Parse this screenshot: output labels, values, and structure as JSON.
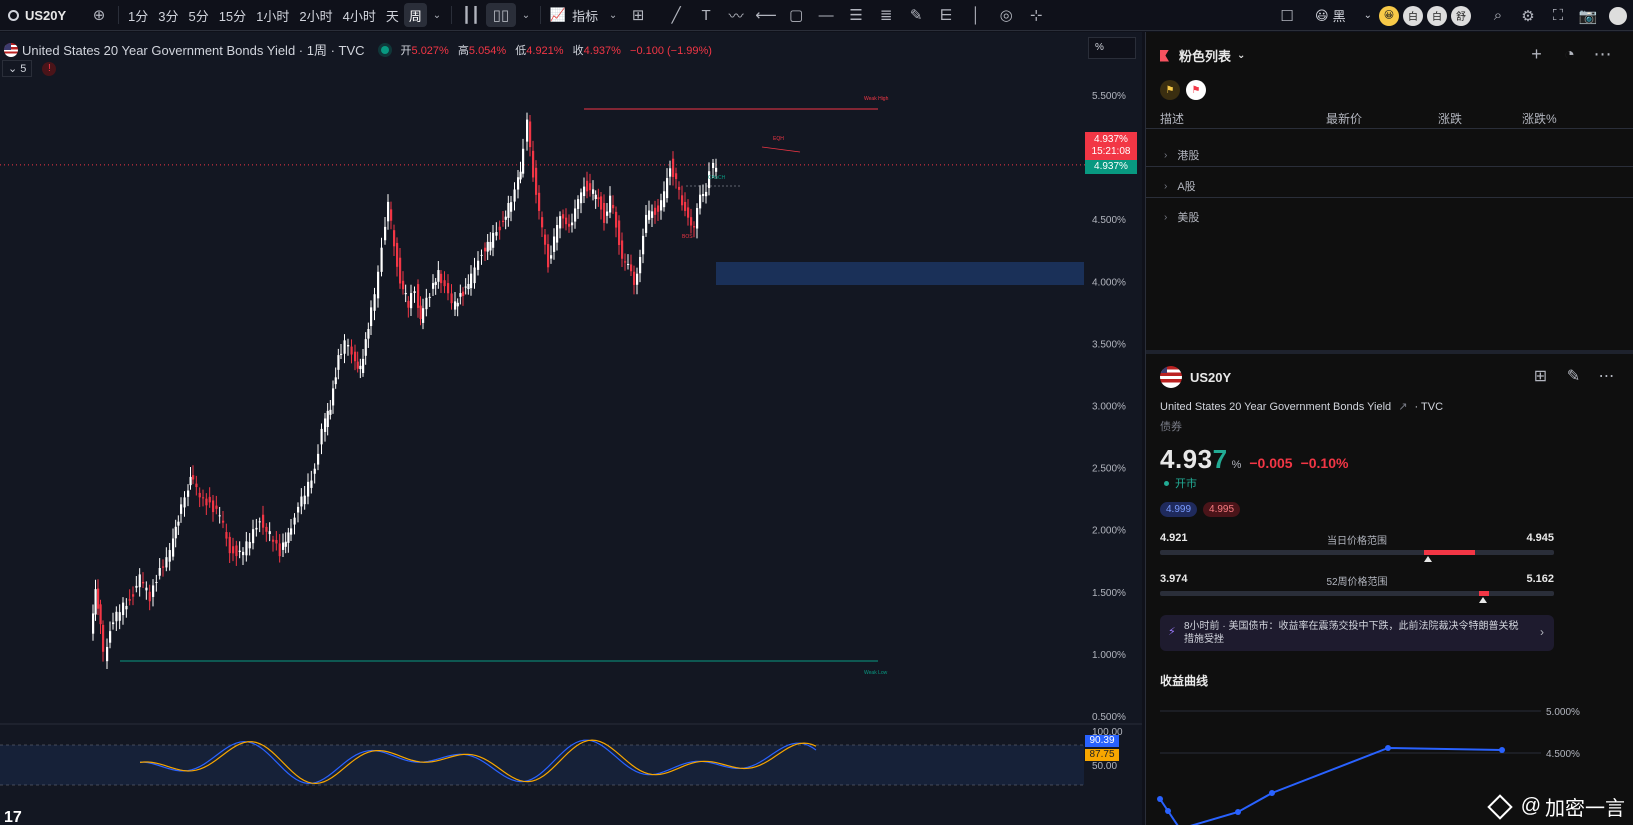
{
  "topbar": {
    "symbol": "US20Y",
    "intervals": [
      "1分",
      "3分",
      "5分",
      "15分",
      "1小时",
      "2小时",
      "4小时",
      "天",
      "周"
    ],
    "active_interval": "周",
    "indicators_label": "指标",
    "theme_label": "黑",
    "coins": [
      "😀",
      "白",
      "白",
      "舒"
    ]
  },
  "legend": {
    "title": "United States 20 Year Government Bonds Yield · 1周 · TVC",
    "open_label": "开",
    "open": "5.027%",
    "high_label": "高",
    "high": "5.054%",
    "low_label": "低",
    "low": "4.921%",
    "close_label": "收",
    "close": "4.937%",
    "change": "−0.100 (−1.99%)",
    "indicator_count": "5",
    "warning": "!"
  },
  "price_axis": {
    "unit_box": "%",
    "labels": [
      "5.500%",
      "5.000%",
      "4.500%",
      "4.000%",
      "3.500%",
      "3.000%",
      "2.500%",
      "2.000%",
      "1.500%",
      "1.000%",
      "0.500%"
    ],
    "last_price": "4.937%",
    "countdown": "15:21:08",
    "bid_price": "4.937%"
  },
  "annotations": {
    "weak_high": "Weak High",
    "weak_low": "Weak Low",
    "eqh": "EQH",
    "choch": "CHoCH",
    "bos": "BOS"
  },
  "oscillator": {
    "labels": [
      "100.00",
      "50.00"
    ],
    "value1": "90.39",
    "value2": "87.75",
    "color1": "#2962ff",
    "color2": "#f7a600"
  },
  "watchlist": {
    "title": "粉色列表",
    "columns": [
      "描述",
      "最新价",
      "涨跌",
      "涨跌%"
    ],
    "groups": [
      "港股",
      "A股",
      "美股"
    ]
  },
  "details": {
    "symbol": "US20Y",
    "name": "United States 20 Year Government Bonds Yield",
    "exchange": "TVC",
    "type": "债券",
    "price_main": "4.93",
    "price_last_digit": "7",
    "unit": "%",
    "change": "−0.005",
    "change_pct": "−0.10%",
    "status": "开市",
    "bid": "4.999",
    "ask": "4.995",
    "day_range": {
      "label": "当日价格范围",
      "low": "4.921",
      "high": "4.945"
    },
    "week52_range": {
      "label": "52周价格范围",
      "low": "3.974",
      "high": "5.162"
    },
    "news": "8小时前 · 美国债市：收益率在震荡交投中下跌，此前法院裁决令特朗普关税措施受挫",
    "yield_curve_title": "收益曲线",
    "yield_curve_labels": [
      "5.000%",
      "4.500%"
    ]
  },
  "watermark": "加密一言",
  "colors": {
    "up": "#ffffff",
    "down": "#f23645",
    "accent": "#2962ff",
    "green": "#089981"
  }
}
